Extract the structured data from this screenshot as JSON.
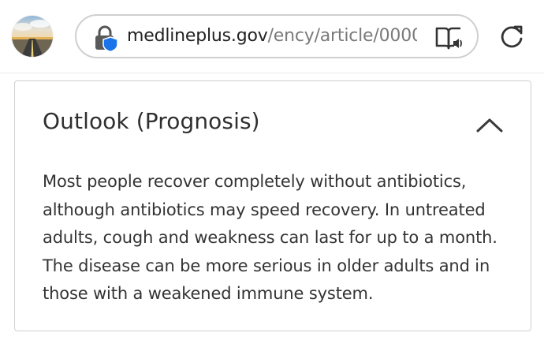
{
  "browser": {
    "url_domain": "medlineplus.gov",
    "url_path": "/ency/article/0000",
    "icons": {
      "site": "lock-shield-icon",
      "reader": "reader-mode-icon",
      "reload": "reload-icon",
      "avatar": "profile-avatar"
    },
    "colors": {
      "shield": "#1a73e8",
      "lock": "#555555"
    }
  },
  "section": {
    "title": "Outlook (Prognosis)",
    "toggle_icon": "chevron-up-icon",
    "body": "Most people recover completely without antibiotics, although antibiotics may speed recovery. In untreated adults, cough and weakness can last for up to a month. The disease can be more serious in older adults and in those with a weakened immune system."
  }
}
